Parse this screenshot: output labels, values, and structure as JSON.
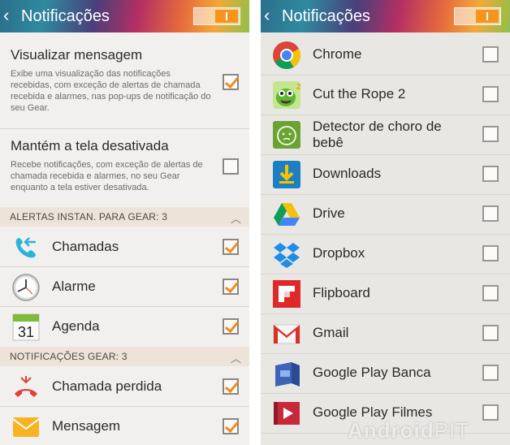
{
  "left_screen": {
    "title": "Notificações",
    "back_glyph": "‹",
    "toggle": {
      "state": "on",
      "label": ""
    },
    "settings": [
      {
        "title": "Visualizar mensagem",
        "description": "Exibe uma visualização das notificações recebidas, com exceção de alertas de chamada recebida e alarmes, nas pop-ups de notificação do seu Gear.",
        "checked": true
      },
      {
        "title": "Mantém a tela desativada",
        "description": "Recebe notificações, com exceção de alertas de chamada recebida e alarmes, no seu Gear enquanto a tela estiver desativada.",
        "checked": false
      }
    ],
    "sections": [
      {
        "header": "ALERTAS INSTAN. PARA GEAR: 3",
        "items": [
          {
            "name": "Chamadas",
            "icon": "incoming-call-icon",
            "checked": true
          },
          {
            "name": "Alarme",
            "icon": "clock-icon",
            "checked": true
          },
          {
            "name": "Agenda",
            "icon": "calendar-icon",
            "checked": true
          }
        ]
      },
      {
        "header": "NOTIFICAÇÕES GEAR: 3",
        "items": [
          {
            "name": "Chamada perdida",
            "icon": "missed-call-icon",
            "checked": true
          },
          {
            "name": "Mensagem",
            "icon": "message-icon",
            "checked": true
          }
        ]
      }
    ],
    "calendar_day": "31"
  },
  "right_screen": {
    "title": "Notificações",
    "back_glyph": "‹",
    "apps": [
      {
        "name": "Chrome",
        "icon": "chrome-icon",
        "checked": false
      },
      {
        "name": "Cut the Rope 2",
        "icon": "cut-the-rope-icon",
        "checked": false
      },
      {
        "name": "Detector de choro de bebê",
        "icon": "baby-cry-detector-icon",
        "checked": false
      },
      {
        "name": "Downloads",
        "icon": "downloads-icon",
        "checked": false
      },
      {
        "name": "Drive",
        "icon": "drive-icon",
        "checked": false
      },
      {
        "name": "Dropbox",
        "icon": "dropbox-icon",
        "checked": false
      },
      {
        "name": "Flipboard",
        "icon": "flipboard-icon",
        "checked": false
      },
      {
        "name": "Gmail",
        "icon": "gmail-icon",
        "checked": false
      },
      {
        "name": "Google Play Banca",
        "icon": "play-newsstand-icon",
        "checked": false
      },
      {
        "name": "Google Play Filmes",
        "icon": "play-movies-icon",
        "checked": false
      }
    ]
  },
  "watermark": {
    "brand": "Android",
    "suffix": "PIT"
  },
  "colors": {
    "accent": "#f08a1c",
    "section_bg": "#ede3d8"
  }
}
